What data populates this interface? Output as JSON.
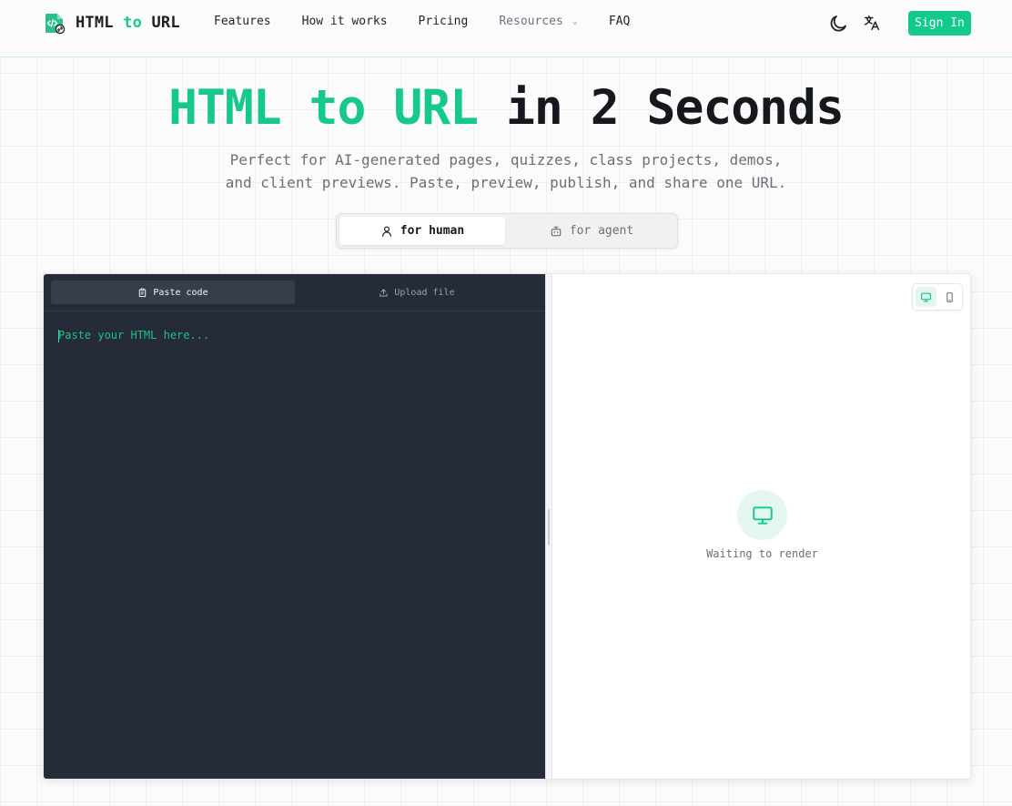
{
  "brand": {
    "name_part1": "HTML",
    "name_part2": "to",
    "name_part3": "URL",
    "accent_color": "#16c98a"
  },
  "nav": {
    "links": [
      {
        "label": "Features"
      },
      {
        "label": "How it works"
      },
      {
        "label": "Pricing"
      },
      {
        "label": "Resources"
      },
      {
        "label": "FAQ"
      }
    ],
    "theme_icon": "moon-icon",
    "language_icon": "translate-icon",
    "signin_label": "Sign In"
  },
  "hero": {
    "title_green": "HTML to URL",
    "title_dark": "in 2 Seconds",
    "subtitle_line1": "Perfect for AI-generated pages, quizzes, class projects, demos,",
    "subtitle_line2": "and client previews. Paste, preview, publish, and share one URL."
  },
  "mode_toggle": {
    "options": [
      {
        "label": "for human",
        "icon": "user-icon",
        "selected": true
      },
      {
        "label": "for agent",
        "icon": "bot-icon",
        "selected": false
      }
    ]
  },
  "editor": {
    "tabs": [
      {
        "label": "Paste code",
        "icon": "clipboard-icon",
        "selected": true
      },
      {
        "label": "Upload file",
        "icon": "upload-icon",
        "selected": false
      }
    ],
    "placeholder": "Paste your HTML here...",
    "value": ""
  },
  "preview": {
    "device_options": [
      {
        "name": "desktop",
        "icon": "monitor-icon",
        "selected": true
      },
      {
        "name": "mobile",
        "icon": "smartphone-icon",
        "selected": false
      }
    ],
    "status_icon": "monitor-icon",
    "status_text": "Waiting to render"
  }
}
